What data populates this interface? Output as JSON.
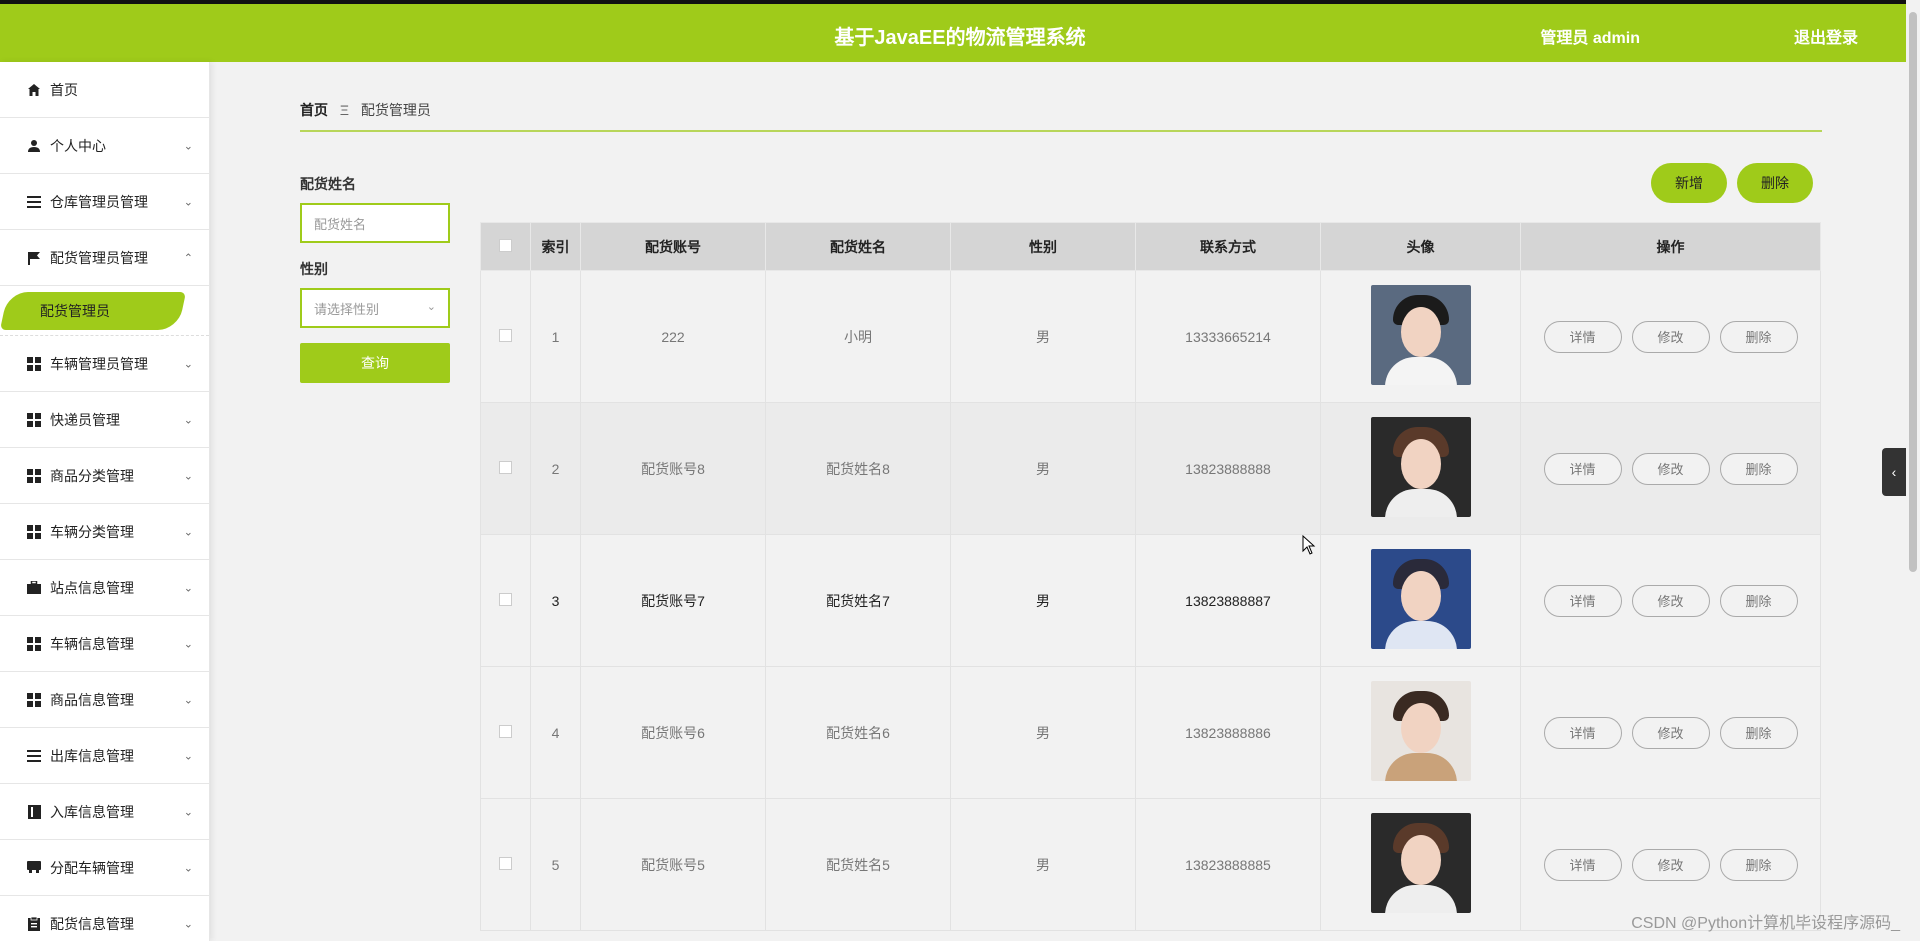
{
  "header": {
    "title": "基于JavaEE的物流管理系统",
    "admin": "管理员 admin",
    "logout": "退出登录"
  },
  "sidebar": {
    "items": [
      {
        "label": "首页",
        "icon": "home-icon"
      },
      {
        "label": "个人中心",
        "icon": "user-icon"
      },
      {
        "label": "仓库管理员管理",
        "icon": "list-icon"
      },
      {
        "label": "配货管理员管理",
        "icon": "flag-icon"
      },
      {
        "label": "车辆管理员管理",
        "icon": "grid-icon"
      },
      {
        "label": "快递员管理",
        "icon": "grid-icon"
      },
      {
        "label": "商品分类管理",
        "icon": "grid-icon"
      },
      {
        "label": "车辆分类管理",
        "icon": "grid-icon"
      },
      {
        "label": "站点信息管理",
        "icon": "briefcase-icon"
      },
      {
        "label": "车辆信息管理",
        "icon": "grid-icon"
      },
      {
        "label": "商品信息管理",
        "icon": "grid-icon"
      },
      {
        "label": "出库信息管理",
        "icon": "list-icon"
      },
      {
        "label": "入库信息管理",
        "icon": "book-icon"
      },
      {
        "label": "分配车辆管理",
        "icon": "truck-icon"
      },
      {
        "label": "配货信息管理",
        "icon": "clipboard-icon"
      }
    ],
    "sub_active": "配货管理员"
  },
  "breadcrumb": {
    "home": "首页",
    "sep": "Ξ",
    "current": "配货管理员"
  },
  "filters": {
    "name_label": "配货姓名",
    "name_placeholder": "配货姓名",
    "gender_label": "性别",
    "gender_placeholder": "请选择性别",
    "query": "查询"
  },
  "actions": {
    "add": "新增",
    "delete": "删除"
  },
  "table": {
    "headers": [
      "索引",
      "配货账号",
      "配货姓名",
      "性别",
      "联系方式",
      "头像",
      "操作"
    ],
    "rows": [
      {
        "idx": "1",
        "account": "222",
        "name": "小明",
        "gender": "男",
        "phone": "13333665214"
      },
      {
        "idx": "2",
        "account": "配货账号8",
        "name": "配货姓名8",
        "gender": "男",
        "phone": "13823888888"
      },
      {
        "idx": "3",
        "account": "配货账号7",
        "name": "配货姓名7",
        "gender": "男",
        "phone": "13823888887"
      },
      {
        "idx": "4",
        "account": "配货账号6",
        "name": "配货姓名6",
        "gender": "男",
        "phone": "13823888886"
      },
      {
        "idx": "5",
        "account": "配货账号5",
        "name": "配货姓名5",
        "gender": "男",
        "phone": "13823888885"
      }
    ],
    "ops": {
      "detail": "详情",
      "edit": "修改",
      "delete": "删除"
    }
  },
  "watermark": "CSDN @Python计算机毕设程序源码_",
  "colors": {
    "accent": "#9fcb1a"
  }
}
